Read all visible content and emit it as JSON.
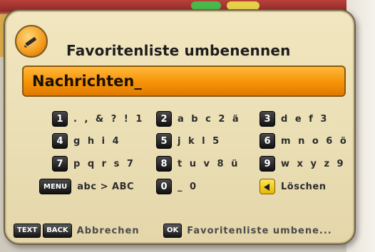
{
  "dialog": {
    "title": "Favoritenliste umbenennen",
    "input_value": "Nachrichten_",
    "icon": "pencil-icon"
  },
  "keypad": [
    {
      "key": "1",
      "chars": ". , & ? ! 1"
    },
    {
      "key": "2",
      "chars": "a b c 2 ä"
    },
    {
      "key": "3",
      "chars": "d e f 3"
    },
    {
      "key": "4",
      "chars": "g h i 4"
    },
    {
      "key": "5",
      "chars": "j k l 5"
    },
    {
      "key": "6",
      "chars": "m n o 6 ö"
    },
    {
      "key": "7",
      "chars": "p q r s 7"
    },
    {
      "key": "8",
      "chars": "t u v 8 ü"
    },
    {
      "key": "9",
      "chars": "w x y z 9"
    }
  ],
  "bottom_row": {
    "menu_key": "MENU",
    "menu_label": "abc > ABC",
    "zero_key": "0",
    "zero_label": "_ 0",
    "delete_key_icon": "left-arrow-icon",
    "delete_label": "Löschen"
  },
  "footer": {
    "text_key": "TEXT",
    "back_key": "BACK",
    "cancel_label": "Abbrechen",
    "ok_key": "OK",
    "ok_label": "Favoritenliste umbene..."
  },
  "colors": {
    "accent": "#f59207",
    "panel": "#ebdfb6",
    "key": "#111111"
  }
}
